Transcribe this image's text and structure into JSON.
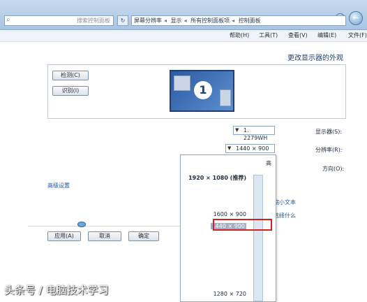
{
  "window": {
    "search_placeholder": "搜索控制面板",
    "address_parts": [
      "控制面板",
      "所有控制面板项",
      "显示",
      "屏幕分辨率"
    ],
    "nav_back": "←",
    "nav_forward": "→",
    "refresh": "↻"
  },
  "menu": {
    "items": [
      "文件(F)",
      "编辑(E)",
      "查看(V)",
      "工具(T)",
      "帮助(H)"
    ]
  },
  "page": {
    "title": "更改显示器的外观",
    "detect_button": "检测(C)",
    "identify_button": "识别(I)",
    "monitor_number": "1",
    "display_label": "显示器(S):",
    "display_value": "1. 2279WH",
    "resolution_label": "分辨率(R):",
    "resolution_value": "1440 × 900",
    "orientation_label": "方向(O):",
    "advanced_link": "高级设置",
    "link_text_size": "放大或缩小文本",
    "link_which": "我应该选择什么",
    "ok_button": "确定",
    "cancel_button": "取消",
    "apply_button": "应用(A)"
  },
  "resolution_dropdown": {
    "high_label": "高",
    "options": [
      {
        "label": "1920 × 1080 (推荐)",
        "bold": true,
        "selected": false
      },
      {
        "label": "1600 × 900",
        "bold": false,
        "selected": false
      },
      {
        "label": "1440 × 900",
        "bold": false,
        "selected": true
      },
      {
        "label": "1280 × 720",
        "bold": false,
        "selected": false
      }
    ]
  },
  "watermark": "头条号 / 电脑技术学习"
}
